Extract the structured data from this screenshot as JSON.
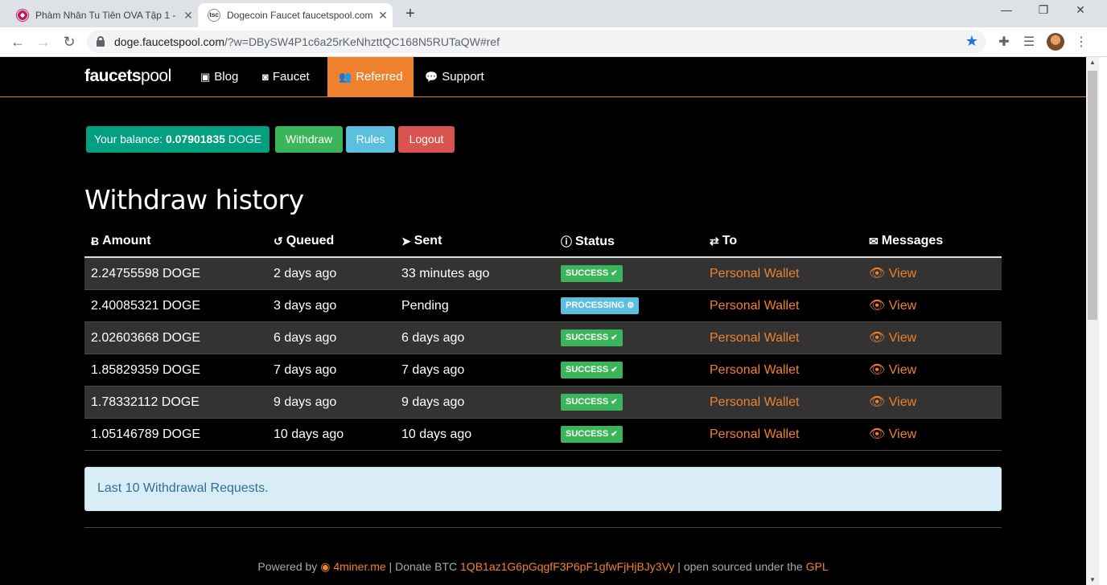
{
  "browser": {
    "tabs": [
      {
        "title": "Phàm Nhân Tu Tiên OVA Tập 1 -",
        "close": "✕"
      },
      {
        "title": "Dogecoin Faucet faucetspool.com",
        "favicon_text": "tsc",
        "close": "✕"
      }
    ],
    "new_tab": "+",
    "window_controls": {
      "minimize": "—",
      "maximize": "❐",
      "close": "✕"
    },
    "url_host": "doge.faucetspool.com",
    "url_rest": "/?w=DBySW4P1c6a25rKeNhzttQC168N5RUTaQW#ref",
    "nav": {
      "back": "←",
      "forward": "→",
      "reload": "↻"
    },
    "star": "★",
    "extensions": {
      "puzzle": "✚",
      "media": "☰",
      "menu": "⋮"
    }
  },
  "site": {
    "brand_bold": "faucets",
    "brand_light": "pool",
    "nav": [
      {
        "label": "Blog",
        "icon": "rss-icon",
        "glyph": "▣"
      },
      {
        "label": "Faucet",
        "icon": "money-icon",
        "glyph": "◙"
      },
      {
        "label": "Referred",
        "icon": "users-icon",
        "glyph": "👥",
        "active": true
      },
      {
        "label": "Support",
        "icon": "comments-icon",
        "glyph": "💬"
      }
    ],
    "balance_prefix": "Your balance: ",
    "balance_value": "0.07901835",
    "balance_unit": " DOGE",
    "buttons": {
      "withdraw": "Withdraw",
      "rules": "Rules",
      "logout": "Logout"
    }
  },
  "history": {
    "title": "Withdraw history",
    "columns": {
      "amount": {
        "label": "Amount",
        "glyph": "Ƀ"
      },
      "queued": {
        "label": "Queued",
        "glyph": "↺"
      },
      "sent": {
        "label": "Sent",
        "glyph": "➤"
      },
      "status": {
        "label": "Status",
        "glyph": "ⓘ"
      },
      "to": {
        "label": "To",
        "glyph": "⇄"
      },
      "messages": {
        "label": "Messages",
        "glyph": "✉"
      }
    },
    "rows": [
      {
        "amount": "2.24755598 DOGE",
        "queued": "2 days ago",
        "sent": "33 minutes ago",
        "status": "SUCCESS",
        "status_glyph": "✔",
        "to": "Personal Wallet",
        "message": "View"
      },
      {
        "amount": "2.40085321 DOGE",
        "queued": "3 days ago",
        "sent": "Pending",
        "status": "PROCESSING",
        "status_glyph": "⚙",
        "to": "Personal Wallet",
        "message": "View"
      },
      {
        "amount": "2.02603668 DOGE",
        "queued": "6 days ago",
        "sent": "6 days ago",
        "status": "SUCCESS",
        "status_glyph": "✔",
        "to": "Personal Wallet",
        "message": "View"
      },
      {
        "amount": "1.85829359 DOGE",
        "queued": "7 days ago",
        "sent": "7 days ago",
        "status": "SUCCESS",
        "status_glyph": "✔",
        "to": "Personal Wallet",
        "message": "View"
      },
      {
        "amount": "1.78332112 DOGE",
        "queued": "9 days ago",
        "sent": "9 days ago",
        "status": "SUCCESS",
        "status_glyph": "✔",
        "to": "Personal Wallet",
        "message": "View"
      },
      {
        "amount": "1.05146789 DOGE",
        "queued": "10 days ago",
        "sent": "10 days ago",
        "status": "SUCCESS",
        "status_glyph": "✔",
        "to": "Personal Wallet",
        "message": "View"
      }
    ],
    "view_glyph": "👁",
    "alert": "Last 10 Withdrawal Requests."
  },
  "footer": {
    "powered": "Powered by ",
    "github_glyph": "◉",
    "miner": "4miner.me",
    "donate": " | Donate BTC ",
    "btc_address": "1QB1az1G6pGqgfF3P6pF1gfwFjHjBJy3Vy",
    "sourced": " | open sourced under the ",
    "license": "GPL"
  },
  "colors": {
    "accent": "#f0812c",
    "success": "#3ab55a",
    "info": "#5bc0de",
    "danger": "#d9534f",
    "balance": "#00a080"
  }
}
